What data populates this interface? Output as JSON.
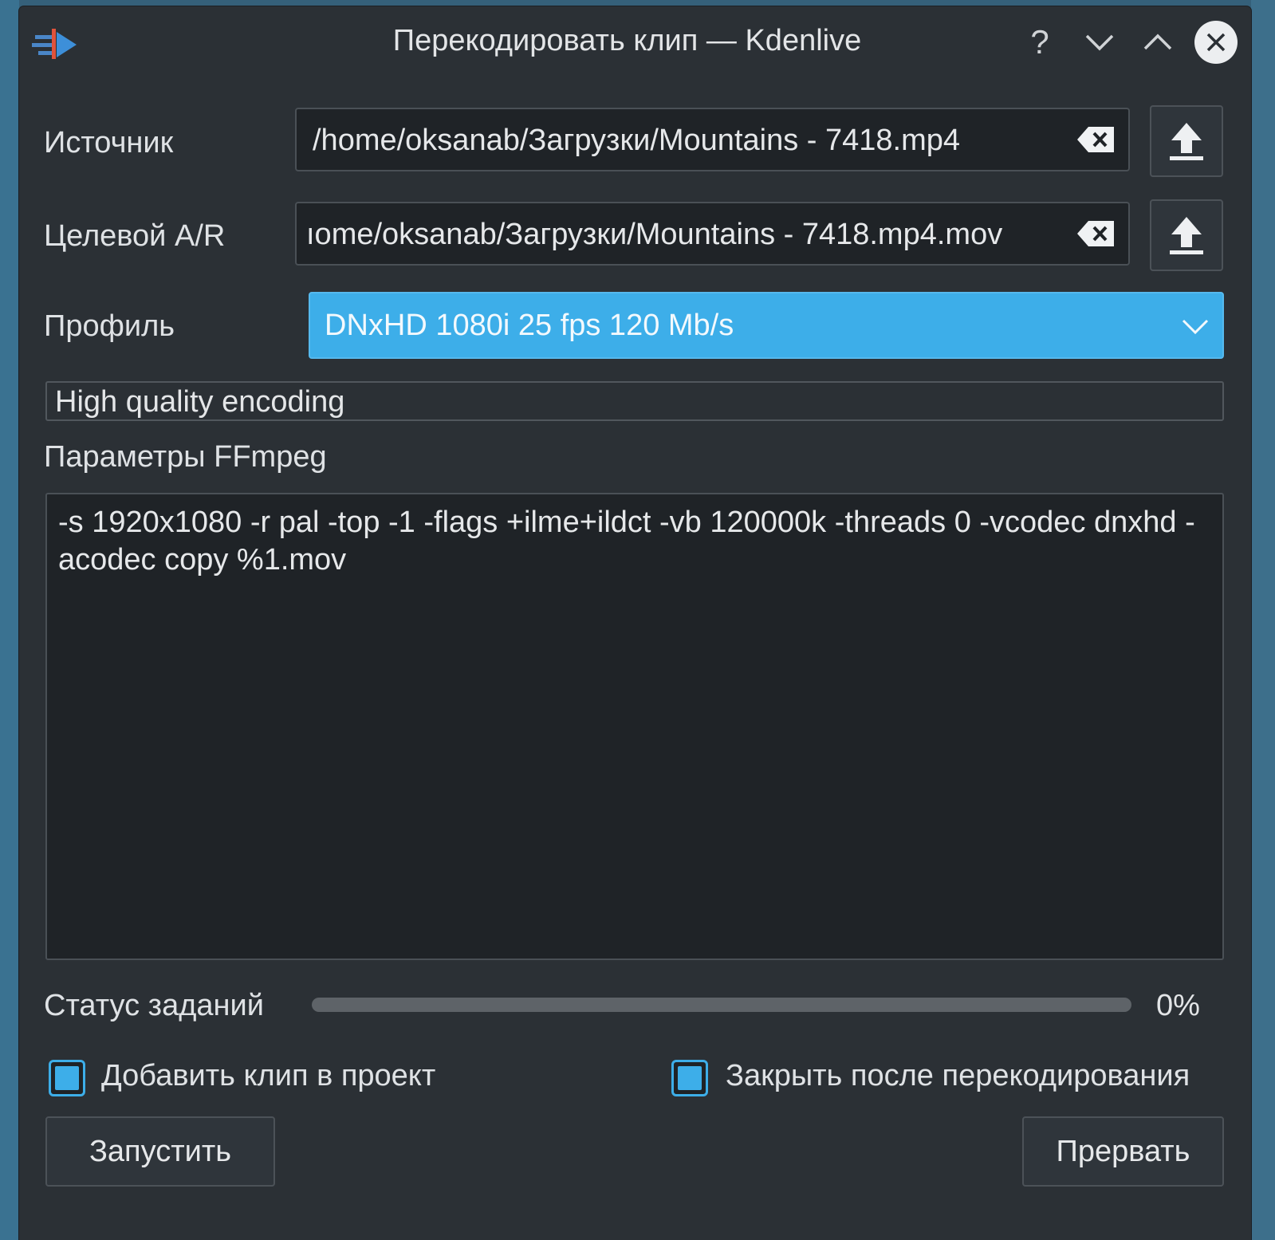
{
  "window": {
    "title": "Перекодировать клип — Kdenlive",
    "help_glyph": "?",
    "accent_color": "#3daee9"
  },
  "form": {
    "source_label": "Источник",
    "source_value": "/home/oksanab/Загрузки/Mountains - 7418.mp4",
    "target_label": "Целевой A/R",
    "target_value": "ıome/oksanab/Загрузки/Mountains - 7418.mp4.mov",
    "profile_label": "Профиль",
    "profile_selected": "DNxHD 1080i 25 fps 120 Mb/s",
    "profile_description": "High quality encoding",
    "ffmpeg_label": "Параметры FFmpeg",
    "ffmpeg_params": "-s 1920x1080 -r pal -top -1 -flags +ilme+ildct -vb 120000k -threads 0 -vcodec dnxhd -acodec copy %1.mov"
  },
  "status": {
    "label": "Статус заданий",
    "progress_percent": 0,
    "progress_text": "0%"
  },
  "options": {
    "add_to_project_label": "Добавить клип в проект",
    "add_to_project_checked": true,
    "close_after_label": "Закрыть после перекодирования",
    "close_after_checked": true
  },
  "buttons": {
    "start_label": "Запустить",
    "abort_label": "Прервать"
  },
  "icons": {
    "app": "kdenlive-icon",
    "clear": "clear-text-icon",
    "upload": "open-file-icon",
    "dropdown": "chevron-down-icon"
  }
}
